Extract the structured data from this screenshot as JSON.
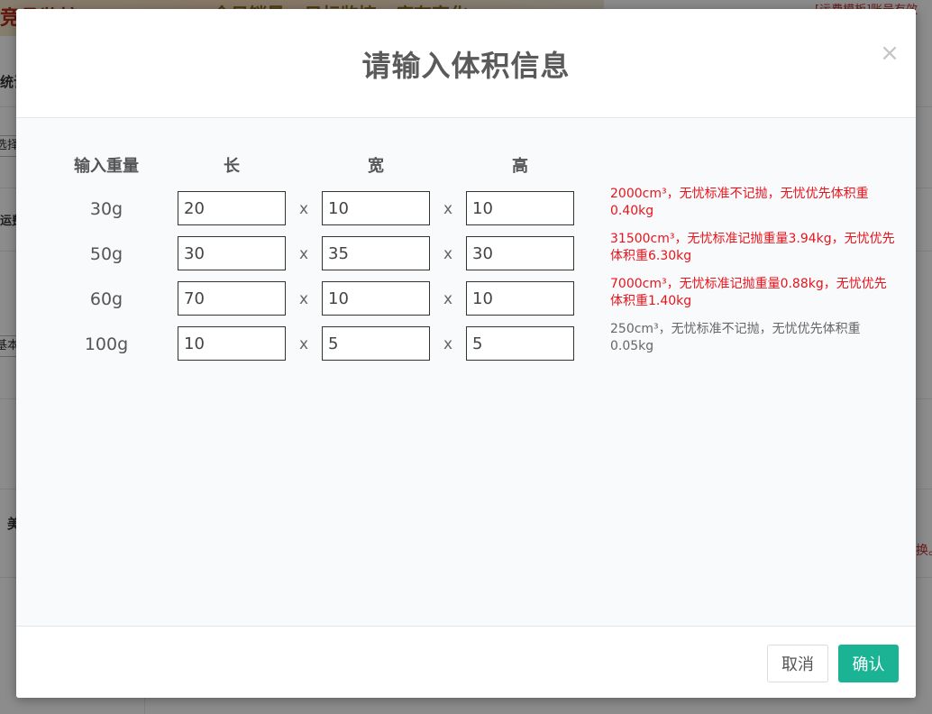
{
  "background": {
    "banner_left": "竞品监控",
    "banner_mid": "今日销量 · 目标监控 · 库存变化",
    "right_link": "[运费模板]账号有效",
    "left_labels": [
      "统计",
      "选择",
      "运费",
      "基本",
      "美"
    ],
    "right_red": "换。"
  },
  "modal": {
    "title": "请输入体积信息",
    "close_symbol": "×",
    "columns": {
      "weight": "输入重量",
      "length": "长",
      "width": "宽",
      "height": "高"
    },
    "times_symbol": "x",
    "rows": [
      {
        "weight": "30g",
        "length": "20",
        "width": "10",
        "height": "10",
        "result": "2000cm³，无忧标准不记抛，无忧优先体积重0.40kg",
        "result_color": "#e8141b"
      },
      {
        "weight": "50g",
        "length": "30",
        "width": "35",
        "height": "30",
        "result": "31500cm³，无忧标准记抛重量3.94kg，无忧优先体积重6.30kg",
        "result_color": "#e8141b"
      },
      {
        "weight": "60g",
        "length": "70",
        "width": "10",
        "height": "10",
        "result": "7000cm³，无忧标准记抛重量0.88kg，无忧优先体积重1.40kg",
        "result_color": "#e8141b"
      },
      {
        "weight": "100g",
        "length": "10",
        "width": "5",
        "height": "5",
        "result": "250cm³，无忧标准不记抛，无忧优先体积重0.05kg",
        "result_color": "#666666"
      }
    ],
    "buttons": {
      "cancel": "取消",
      "confirm": "确认"
    },
    "confirm_color": "#1ab394"
  }
}
